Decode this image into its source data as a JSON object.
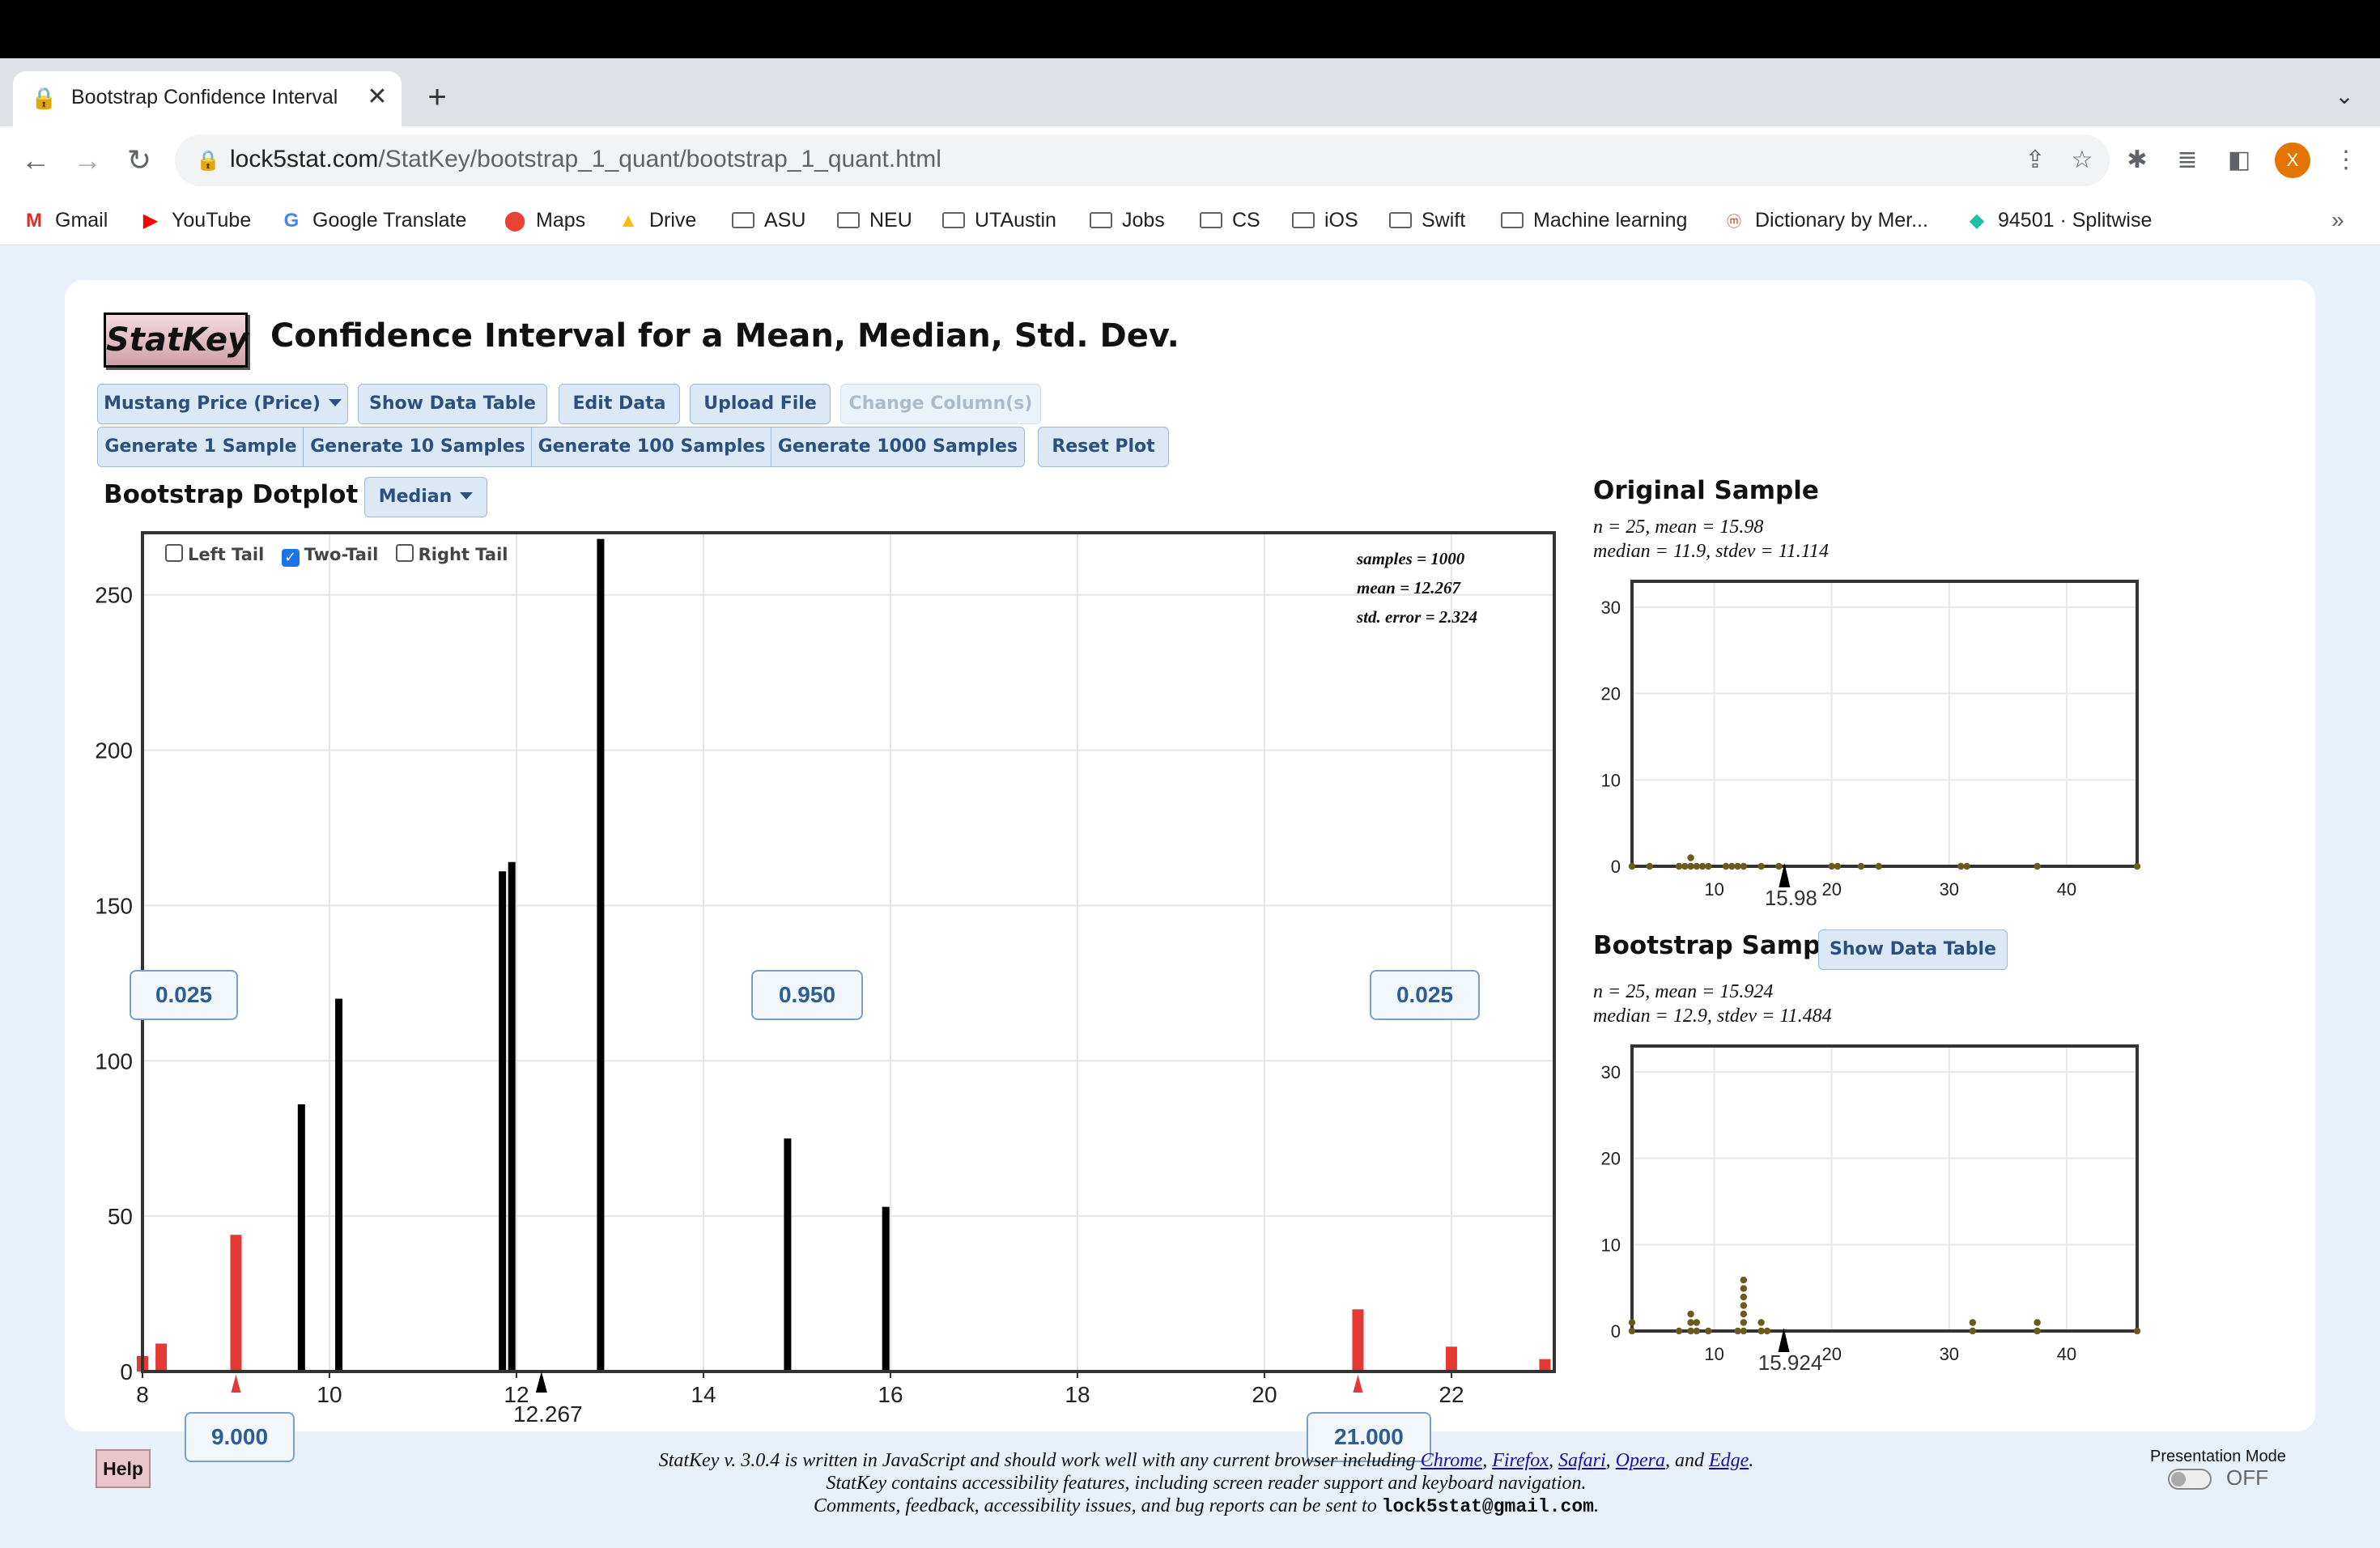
{
  "browser": {
    "tab_title": "Bootstrap Confidence Interval",
    "url_host": "lock5stat.com",
    "url_path": "/StatKey/bootstrap_1_quant/bootstrap_1_quant.html",
    "avatar_letter": "X",
    "bookmarks": [
      {
        "label": "Gmail",
        "icon": "gmail-icon"
      },
      {
        "label": "YouTube",
        "icon": "youtube-icon"
      },
      {
        "label": "Google Translate",
        "icon": "translate-icon"
      },
      {
        "label": "Maps",
        "icon": "maps-icon"
      },
      {
        "label": "Drive",
        "icon": "drive-icon"
      },
      {
        "label": "ASU",
        "icon": "folder-icon"
      },
      {
        "label": "NEU",
        "icon": "folder-icon"
      },
      {
        "label": "UTAustin",
        "icon": "folder-icon"
      },
      {
        "label": "Jobs",
        "icon": "folder-icon"
      },
      {
        "label": "CS",
        "icon": "folder-icon"
      },
      {
        "label": "iOS",
        "icon": "folder-icon"
      },
      {
        "label": "Swift",
        "icon": "folder-icon"
      },
      {
        "label": "Machine learning",
        "icon": "folder-icon"
      },
      {
        "label": "Dictionary by Mer...",
        "icon": "dictionary-icon"
      },
      {
        "label": "94501 · Splitwise",
        "icon": "splitwise-icon"
      }
    ]
  },
  "app": {
    "logo": "StatKey",
    "title": "Confidence Interval for a Mean, Median, Std. Dev.",
    "dataset_label": "Mustang Price (Price)",
    "show_data_table": "Show Data Table",
    "edit_data": "Edit Data",
    "upload_file": "Upload File",
    "change_columns": "Change Column(s)",
    "gen1": "Generate 1 Sample",
    "gen10": "Generate 10 Samples",
    "gen100": "Generate 100 Samples",
    "gen1000": "Generate 1000 Samples",
    "reset": "Reset Plot",
    "dotplot_label": "Bootstrap Dotplot of",
    "statistic": "Median",
    "left_tail": "Left Tail",
    "two_tail": "Two-Tail",
    "right_tail": "Right Tail",
    "samples_line": "samples = 1000",
    "mean_line": "mean = 12.267",
    "se_line": "std. error = 2.324",
    "prop_left": "0.025",
    "prop_mid": "0.950",
    "prop_right": "0.025",
    "lower_bound": "9.000",
    "upper_bound": "21.000",
    "mean_marker": "12.267"
  },
  "original": {
    "heading": "Original Sample",
    "line1": "n = 25, mean = 15.98",
    "line2": "median = 11.9, stdev = 11.114",
    "marker": "15.98"
  },
  "bootstrap": {
    "heading": "Bootstrap Sample",
    "button": "Show Data Table",
    "line1": "n = 25, mean = 15.924",
    "line2": "median = 12.9, stdev = 11.484",
    "marker": "15.924"
  },
  "footer": {
    "line1_a": "StatKey v. 3.0.4 is written in JavaScript and should work well with any current browser including ",
    "chrome": "Chrome",
    "sep1": ", ",
    "firefox": "Firefox",
    "sep2": ", ",
    "safari": "Safari",
    "sep3": ", ",
    "opera": "Opera",
    "and": ", and ",
    "edge": "Edge",
    "period": ".",
    "line2": "StatKey contains accessibility features, including screen reader support and keyboard navigation.",
    "line3": "Comments, feedback, accessibility issues, and bug reports can be sent to ",
    "email": "lock5stat@gmail.com",
    "end": ".",
    "help": "Help",
    "presentation_mode": "Presentation Mode",
    "toggle_state": "OFF"
  },
  "chart_data": [
    {
      "type": "bar",
      "name": "bootstrap-dotplot",
      "xlim": [
        8,
        23.1
      ],
      "ylim": [
        0,
        270
      ],
      "xticks": [
        8,
        10,
        12,
        14,
        16,
        18,
        20,
        22
      ],
      "yticks": [
        0,
        50,
        100,
        150,
        200,
        250
      ],
      "x": [
        8.0,
        8.2,
        9.0,
        9.7,
        10.1,
        11.85,
        11.95,
        12.9,
        14.9,
        15.95,
        21.0,
        22.0,
        23.0
      ],
      "values": [
        5,
        9,
        44,
        86,
        120,
        161,
        164,
        268,
        75,
        53,
        20,
        8,
        4
      ],
      "tail": [
        true,
        true,
        true,
        false,
        false,
        false,
        false,
        false,
        false,
        false,
        true,
        true,
        true
      ],
      "colors": {
        "body": "#000000",
        "tail": "#e53935"
      }
    },
    {
      "type": "scatter",
      "name": "original-sample",
      "xlim": [
        3,
        46
      ],
      "ylim": [
        0,
        33
      ],
      "xticks": [
        10,
        20,
        30,
        40
      ],
      "yticks": [
        0,
        10,
        20,
        30
      ],
      "values": [
        3,
        4.5,
        7,
        7.5,
        8,
        8,
        8.5,
        9,
        9.5,
        11,
        11.5,
        12,
        12.5,
        14,
        15.5,
        20,
        20.5,
        22.5,
        24,
        31,
        31.5,
        37.5,
        46
      ]
    },
    {
      "type": "scatter",
      "name": "bootstrap-sample",
      "xlim": [
        3,
        46
      ],
      "ylim": [
        0,
        33
      ],
      "xticks": [
        10,
        20,
        30,
        40
      ],
      "yticks": [
        0,
        10,
        20,
        30
      ],
      "values": [
        3,
        3,
        7,
        8,
        8,
        8,
        8.5,
        8.5,
        9.5,
        12.5,
        12.5,
        12.5,
        12.5,
        12.5,
        12.5,
        12.5,
        12,
        14,
        14,
        14.5,
        32,
        32,
        37.5,
        37.5,
        46
      ]
    }
  ]
}
